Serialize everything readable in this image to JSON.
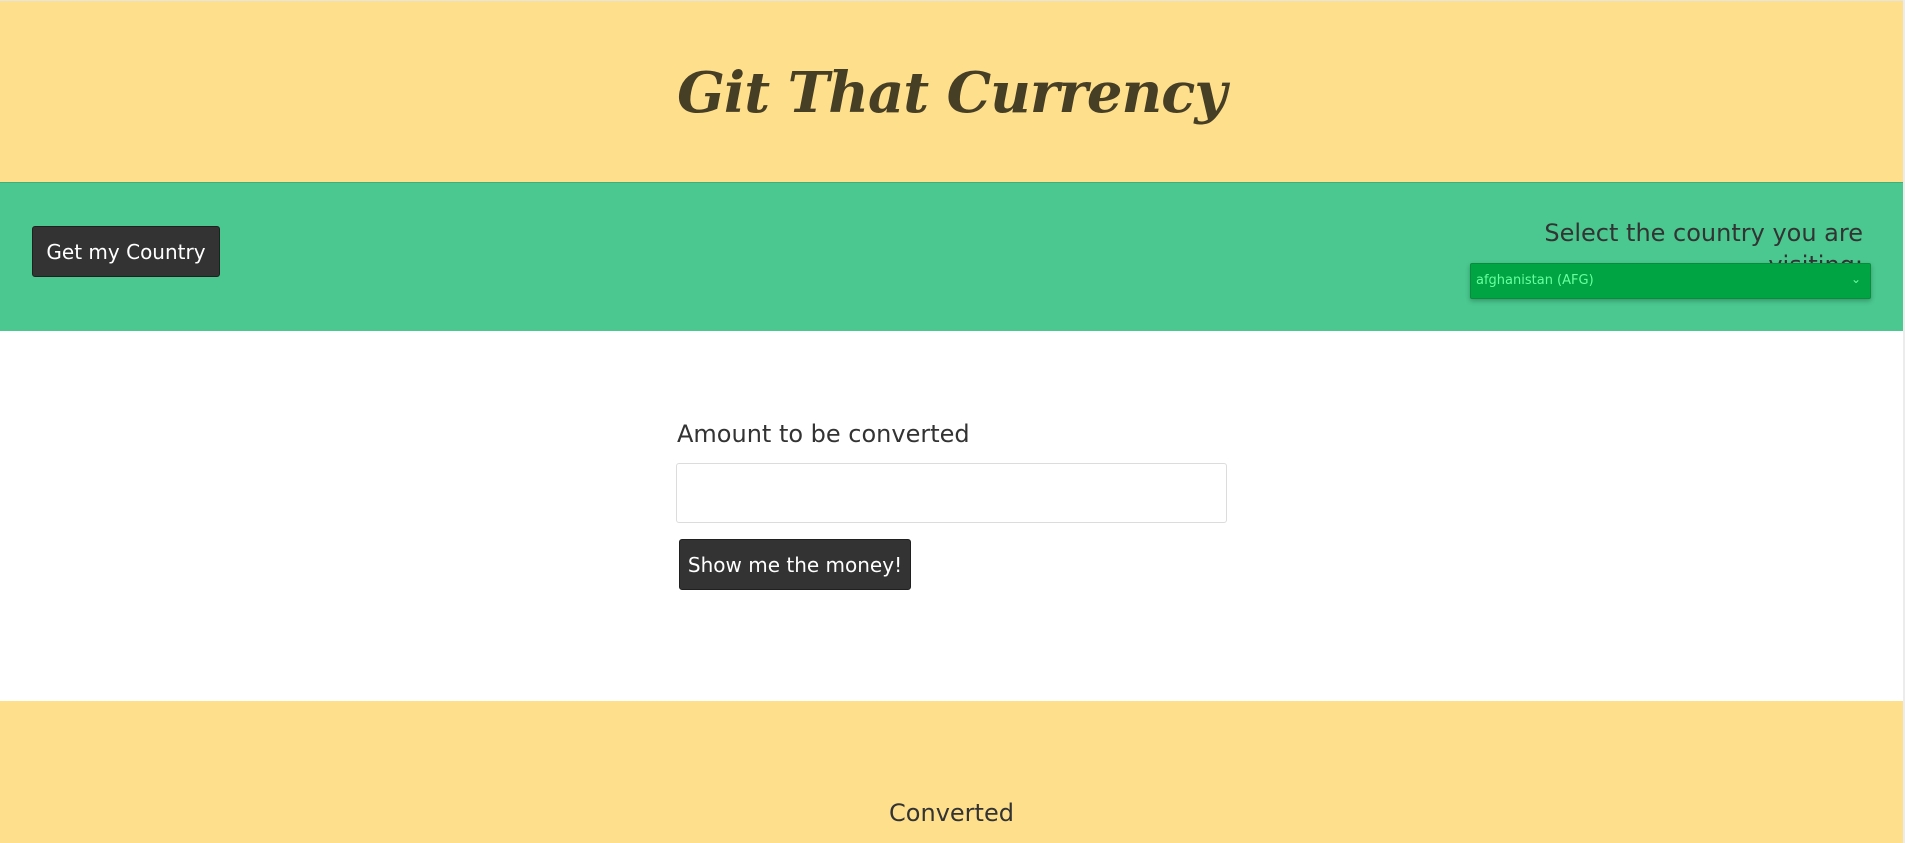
{
  "header": {
    "title": "Git That Currency"
  },
  "controls": {
    "get_country_label": "Get my Country",
    "select_label": "Select the country you are visiting:",
    "country_select": {
      "selected": "afghanistan (AFG)"
    }
  },
  "converter": {
    "amount_label": "Amount to be converted",
    "amount_value": "",
    "submit_label": "Show me the money!"
  },
  "result": {
    "label": "Converted"
  },
  "colors": {
    "header_bg": "#fedf8c",
    "band_bg": "#4ac88f",
    "select_bg": "#00a443",
    "select_text": "#68ff9f",
    "button_bg": "#333333",
    "title_text": "#473f25"
  },
  "icons": {
    "select_arrow": "chevron-down-icon"
  }
}
